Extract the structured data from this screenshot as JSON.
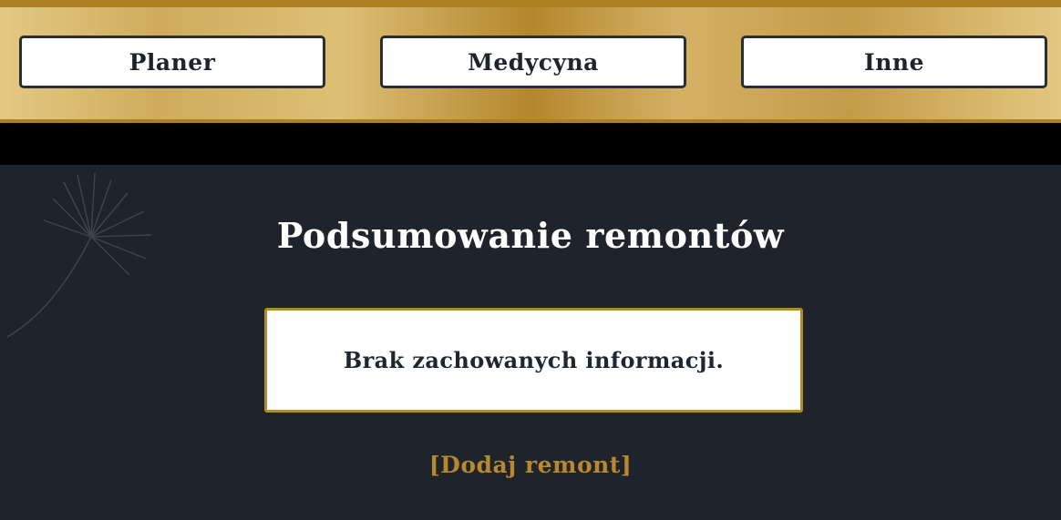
{
  "nav": {
    "items": [
      {
        "label": "Planer"
      },
      {
        "label": "Medycyna"
      },
      {
        "label": "Inne"
      }
    ]
  },
  "main": {
    "title": "Podsumowanie remontów",
    "empty_message": "Brak zachowanych informacji.",
    "add_link": "[Dodaj remont]"
  },
  "colors": {
    "gold_accent": "#b08a2e",
    "background": "#1e232c",
    "link": "#b7882e"
  },
  "decor": {
    "background_icon": "dandelion-icon"
  }
}
